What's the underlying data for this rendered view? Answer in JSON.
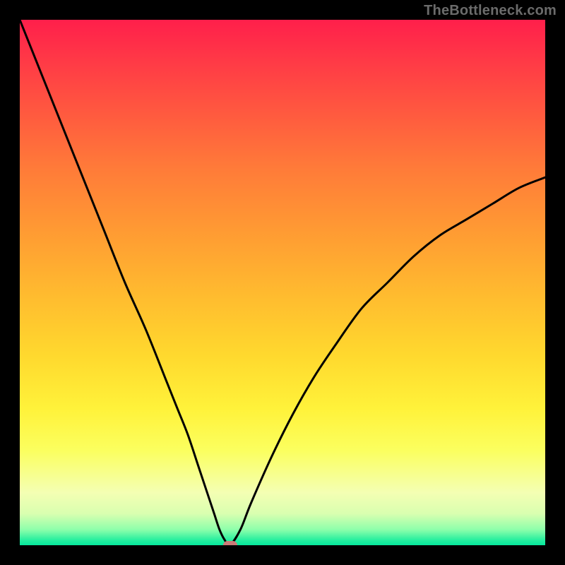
{
  "watermark": "TheBottleneck.com",
  "colors": {
    "frame": "#000000",
    "curve": "#000000",
    "marker": "#cc7b78",
    "watermark": "#6b6b6b"
  },
  "chart_data": {
    "type": "line",
    "title": "",
    "xlabel": "",
    "ylabel": "",
    "xlim": [
      0,
      100
    ],
    "ylim": [
      0,
      100
    ],
    "x": [
      0,
      4,
      8,
      12,
      16,
      20,
      24,
      28,
      30,
      32,
      34,
      36,
      37,
      38,
      39,
      40,
      42,
      44,
      48,
      52,
      56,
      60,
      65,
      70,
      75,
      80,
      85,
      90,
      95,
      100
    ],
    "y": [
      100,
      90,
      80,
      70,
      60,
      50,
      41,
      31,
      26,
      21,
      15,
      9,
      6,
      3,
      1,
      0,
      3,
      8,
      17,
      25,
      32,
      38,
      45,
      50,
      55,
      59,
      62,
      65,
      68,
      70
    ],
    "marker": {
      "x": 40,
      "y": 0
    },
    "grid": false,
    "notes": "Y read in screen-up convention (0 at bottom). Values estimated from gradient bands; no axis ticks present."
  }
}
